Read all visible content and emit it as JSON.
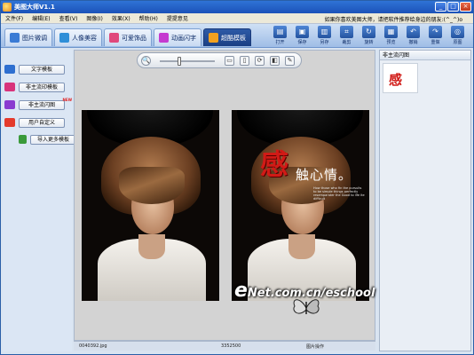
{
  "window": {
    "title": "美图大师V1.1",
    "colors": {
      "titlebar": "#1c52b8",
      "accent_red": "#d11a16",
      "panel": "#dbe6f4"
    }
  },
  "menu": {
    "items": [
      "文件(F)",
      "编辑(E)",
      "查看(V)",
      "图像(I)",
      "效果(X)",
      "帮助(H)",
      "提提意见"
    ],
    "tip": "如果你喜欢美图大师，请把软件推荐给身边的朋友:(^_^)o"
  },
  "tabs": [
    {
      "label": "图片微调",
      "icon": "photo-adjust-icon",
      "color": "#3a7bd5"
    },
    {
      "label": "人像美容",
      "icon": "portrait-icon",
      "color": "#2f8fd8"
    },
    {
      "label": "可爱饰品",
      "icon": "accessory-icon",
      "color": "#e0487c"
    },
    {
      "label": "动画闪字",
      "icon": "animation-icon",
      "color": "#c53ad0"
    },
    {
      "label": "超酷模板",
      "icon": "template-icon",
      "color": "#f2a11f",
      "active": true
    }
  ],
  "toolbar": {
    "tools": [
      {
        "label": "打开",
        "icon": "open-folder-icon",
        "glyph": "▤"
      },
      {
        "label": "保存",
        "icon": "save-icon",
        "glyph": "▣"
      },
      {
        "label": "另存",
        "icon": "save-as-icon",
        "glyph": "▥"
      },
      {
        "label": "裁剪",
        "icon": "crop-icon",
        "glyph": "⌗"
      },
      {
        "label": "旋转",
        "icon": "rotate-icon",
        "glyph": "↻"
      },
      {
        "label": "预览",
        "icon": "preview-icon",
        "glyph": "▦"
      },
      {
        "label": "撤销",
        "icon": "undo-icon",
        "glyph": "↶"
      },
      {
        "label": "重做",
        "icon": "redo-icon",
        "glyph": "↷"
      },
      {
        "label": "原图",
        "icon": "original-icon",
        "glyph": "◎"
      }
    ]
  },
  "left_panel": {
    "items": [
      {
        "label": "文字模板",
        "icon": "text-template-icon",
        "color": "#2e6fd0"
      },
      {
        "label": "非主流印模板",
        "icon": "stamp-template-icon",
        "color": "#d8337b"
      },
      {
        "label": "非主流闪图",
        "icon": "flash-template-icon",
        "color": "#8a3bd0",
        "badge": "NEW"
      },
      {
        "label": "用户自定义",
        "icon": "custom-template-icon",
        "color": "#e43a2c"
      },
      {
        "label": "导入更多模板",
        "icon": "import-icon",
        "color": "#3a9a3a"
      }
    ]
  },
  "zoom": {
    "controls": [
      {
        "name": "zoom-icon",
        "glyph": "🔍"
      },
      {
        "name": "fit-window-icon",
        "glyph": "▭"
      },
      {
        "name": "actual-size-icon",
        "glyph": "▯"
      },
      {
        "name": "reset-icon",
        "glyph": "⟳"
      },
      {
        "name": "compare-icon",
        "glyph": "◧"
      },
      {
        "name": "edit-icon",
        "glyph": "✎"
      }
    ],
    "level": 0.35
  },
  "photo_right": {
    "big_char": "感",
    "small_text": "触心情。",
    "english": "How those who fin the pursuits to be simple things perfectly resemparater the Good to life ite difficult"
  },
  "watermark": {
    "e": "e",
    "net": "Net",
    "domain": ".com.cn/eschool"
  },
  "status": {
    "filename": "0040392.jpg",
    "filesize": "3352500",
    "action": "图片操作"
  },
  "right_panel": {
    "title": "非主流闪图",
    "thumb_char": "感"
  }
}
